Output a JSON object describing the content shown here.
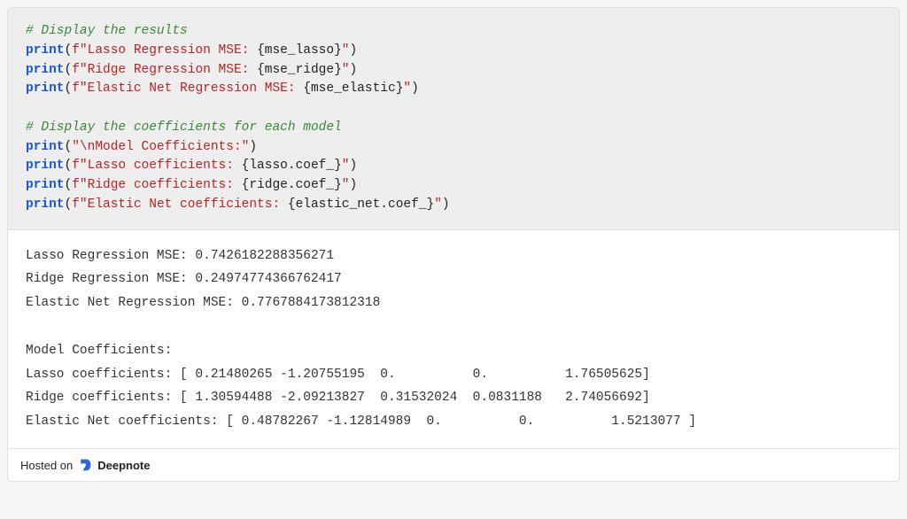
{
  "code": {
    "l1": {
      "comment": "# Display the results"
    },
    "l2": {
      "fn": "print",
      "open": "(",
      "pfx": "f\"",
      "str1": "Lasso Regression MSE: ",
      "br1": "{",
      "var": "mse_lasso",
      "br2": "}",
      "end": "\"",
      "close": ")"
    },
    "l3": {
      "fn": "print",
      "open": "(",
      "pfx": "f\"",
      "str1": "Ridge Regression MSE: ",
      "br1": "{",
      "var": "mse_ridge",
      "br2": "}",
      "end": "\"",
      "close": ")"
    },
    "l4": {
      "fn": "print",
      "open": "(",
      "pfx": "f\"",
      "str1": "Elastic Net Regression MSE: ",
      "br1": "{",
      "var": "mse_elastic",
      "br2": "}",
      "end": "\"",
      "close": ")"
    },
    "l6": {
      "comment": "# Display the coefficients for each model"
    },
    "l7": {
      "fn": "print",
      "open": "(",
      "str": "\"\\nModel Coefficients:\"",
      "close": ")"
    },
    "l8": {
      "fn": "print",
      "open": "(",
      "pfx": "f\"",
      "str1": "Lasso coefficients: ",
      "br1": "{",
      "var": "lasso.coef_",
      "br2": "}",
      "end": "\"",
      "close": ")"
    },
    "l9": {
      "fn": "print",
      "open": "(",
      "pfx": "f\"",
      "str1": "Ridge coefficients: ",
      "br1": "{",
      "var": "ridge.coef_",
      "br2": "}",
      "end": "\"",
      "close": ")"
    },
    "l10": {
      "fn": "print",
      "open": "(",
      "pfx": "f\"",
      "str1": "Elastic Net coefficients: ",
      "br1": "{",
      "var": "elastic_net.coef_",
      "br2": "}",
      "end": "\"",
      "close": ")"
    }
  },
  "output": {
    "line1": "Lasso Regression MSE: 0.7426182288356271",
    "line2": "Ridge Regression MSE: 0.24974774366762417",
    "line3": "Elastic Net Regression MSE: 0.7767884173812318",
    "blank": "",
    "line4": "Model Coefficients:",
    "line5": "Lasso coefficients: [ 0.21480265 -1.20755195  0.          0.          1.76505625]",
    "line6": "Ridge coefficients: [ 1.30594488 -2.09213827  0.31532024  0.0831188   2.74056692]",
    "line7": "Elastic Net coefficients: [ 0.48782267 -1.12814989  0.          0.          1.5213077 ]"
  },
  "footer": {
    "hosted": "Hosted on ",
    "brand": "Deepnote"
  }
}
